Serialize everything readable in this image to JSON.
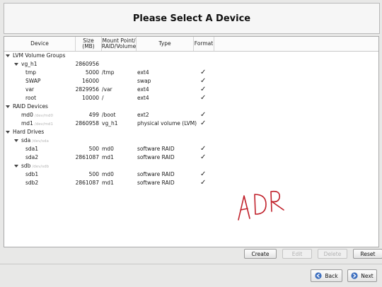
{
  "header": {
    "title": "Please Select A Device"
  },
  "columns": {
    "device": "Device",
    "size_line1": "Size",
    "size_line2": "(MB)",
    "mount_line1": "Mount Point/",
    "mount_line2": "RAID/Volume",
    "type": "Type",
    "format": "Format"
  },
  "rows": [
    {
      "name": "LVM Volume Groups",
      "path": "",
      "size": "",
      "mount": "",
      "type": "",
      "format": false,
      "level": 0,
      "expander": true
    },
    {
      "name": "vg_h1",
      "path": "",
      "size": "2860956",
      "mount": "",
      "type": "",
      "format": false,
      "level": 1,
      "expander": true
    },
    {
      "name": "tmp",
      "path": "",
      "size": "5000",
      "mount": "/tmp",
      "type": "ext4",
      "format": true,
      "level": 2,
      "expander": false
    },
    {
      "name": "SWAP",
      "path": "",
      "size": "16000",
      "mount": "",
      "type": "swap",
      "format": true,
      "level": 2,
      "expander": false
    },
    {
      "name": "var",
      "path": "",
      "size": "2829956",
      "mount": "/var",
      "type": "ext4",
      "format": true,
      "level": 2,
      "expander": false
    },
    {
      "name": "root",
      "path": "",
      "size": "10000",
      "mount": "/",
      "type": "ext4",
      "format": true,
      "level": 2,
      "expander": false
    },
    {
      "name": "RAID Devices",
      "path": "",
      "size": "",
      "mount": "",
      "type": "",
      "format": false,
      "level": 0,
      "expander": true
    },
    {
      "name": "md0",
      "path": "/dev/md0",
      "size": "499",
      "mount": "/boot",
      "type": "ext2",
      "format": true,
      "level": 1,
      "expander": false
    },
    {
      "name": "md1",
      "path": "/dev/md1",
      "size": "2860958",
      "mount": "vg_h1",
      "type": "physical volume (LVM)",
      "format": true,
      "level": 1,
      "expander": false
    },
    {
      "name": "Hard Drives",
      "path": "",
      "size": "",
      "mount": "",
      "type": "",
      "format": false,
      "level": 0,
      "expander": true
    },
    {
      "name": "sda",
      "path": "/dev/sda",
      "size": "",
      "mount": "",
      "type": "",
      "format": false,
      "level": 1,
      "expander": true
    },
    {
      "name": "sda1",
      "path": "",
      "size": "500",
      "mount": "md0",
      "type": "software RAID",
      "format": true,
      "level": 2,
      "expander": false
    },
    {
      "name": "sda2",
      "path": "",
      "size": "2861087",
      "mount": "md1",
      "type": "software RAID",
      "format": true,
      "level": 2,
      "expander": false
    },
    {
      "name": "sdb",
      "path": "/dev/sdb",
      "size": "",
      "mount": "",
      "type": "",
      "format": false,
      "level": 1,
      "expander": true
    },
    {
      "name": "sdb1",
      "path": "",
      "size": "500",
      "mount": "md0",
      "type": "software RAID",
      "format": true,
      "level": 2,
      "expander": false
    },
    {
      "name": "sdb2",
      "path": "",
      "size": "2861087",
      "mount": "md1",
      "type": "software RAID",
      "format": true,
      "level": 2,
      "expander": false
    }
  ],
  "check_glyph": "✓",
  "annotation": {
    "text": "ADR",
    "color": "#c0202a"
  },
  "toolbar": {
    "create": "Create",
    "edit": "Edit",
    "delete": "Delete",
    "reset": "Reset"
  },
  "nav": {
    "back": "Back",
    "next": "Next",
    "back_icon": "back-arrow-icon",
    "next_icon": "next-arrow-icon"
  }
}
